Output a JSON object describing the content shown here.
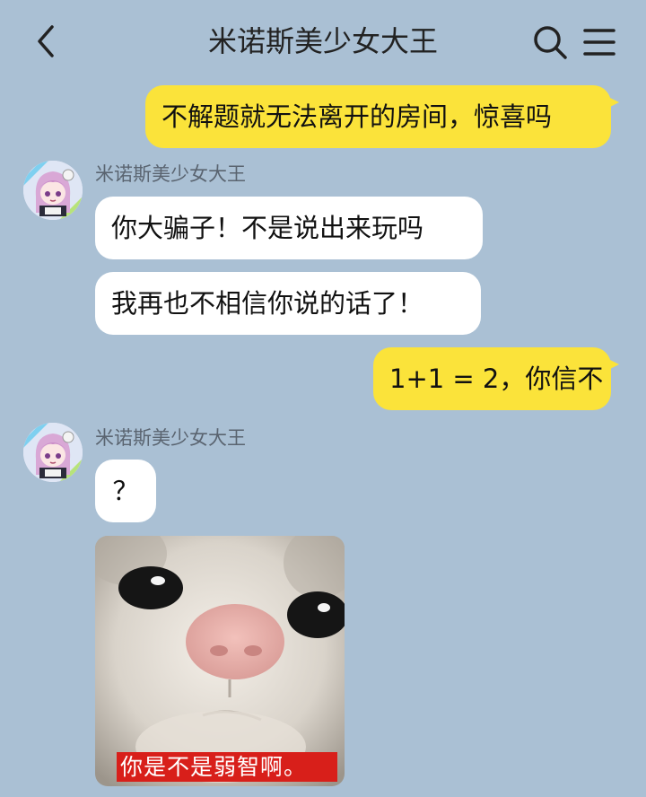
{
  "header": {
    "back_icon": "chevron-left-icon",
    "title": "米诺斯美少女大王",
    "search_icon": "search-icon",
    "menu_icon": "hamburger-menu-icon"
  },
  "messages": [
    {
      "side": "out",
      "text": "不解题就无法离开的房间，惊喜吗"
    },
    {
      "side": "in",
      "sender": "米诺斯美少女大王",
      "text": "你大骗子！不是说出来玩吗"
    },
    {
      "side": "in",
      "text": "我再也不相信你说的话了！"
    },
    {
      "side": "out",
      "text": "1+1 = 2，你信不"
    },
    {
      "side": "in",
      "sender": "米诺斯美少女大王",
      "text": "？"
    },
    {
      "side": "in",
      "sticker": "crying-cat-sticker",
      "caption": "你是不是弱智啊。"
    }
  ],
  "colors": {
    "background": "#aac0d4",
    "outgoing_bubble": "#fbe33a",
    "incoming_bubble": "#ffffff",
    "sticker_caption_bg": "#d81f1a"
  }
}
